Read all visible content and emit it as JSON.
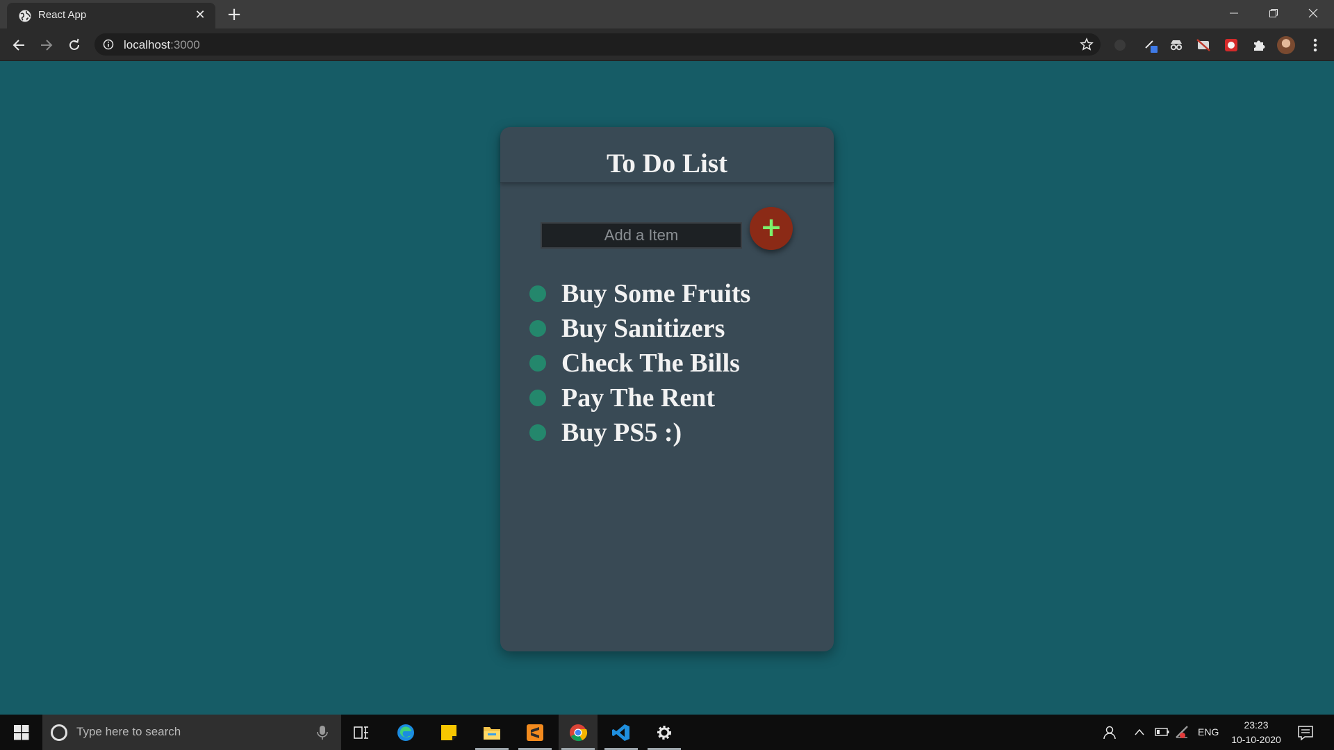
{
  "browser": {
    "tab": {
      "title": "React App",
      "favicon": "globe-icon"
    },
    "url": {
      "host": "localhost",
      "port": ":3000"
    }
  },
  "app": {
    "title": "To Do List",
    "input": {
      "placeholder": "Add a Item",
      "value": ""
    },
    "add_button": {
      "label": "+"
    },
    "items": [
      {
        "text": "Buy Some Fruits"
      },
      {
        "text": "Buy Sanitizers"
      },
      {
        "text": "Check The Bills"
      },
      {
        "text": "Pay The Rent"
      },
      {
        "text": "Buy PS5 :)"
      }
    ],
    "colors": {
      "background": "#165c66",
      "card": "#394a55",
      "dot": "#24876c",
      "add_button": "#8b2a16",
      "plus": "#7cf26c"
    }
  },
  "taskbar": {
    "search_placeholder": "Type here to search",
    "pinned": [
      "task-view-icon",
      "edge-icon",
      "sticky-notes-icon",
      "file-explorer-icon",
      "sublime-text-icon",
      "chrome-icon",
      "vscode-icon",
      "settings-icon"
    ],
    "language": "ENG",
    "time": "23:23",
    "date": "10-10-2020"
  }
}
